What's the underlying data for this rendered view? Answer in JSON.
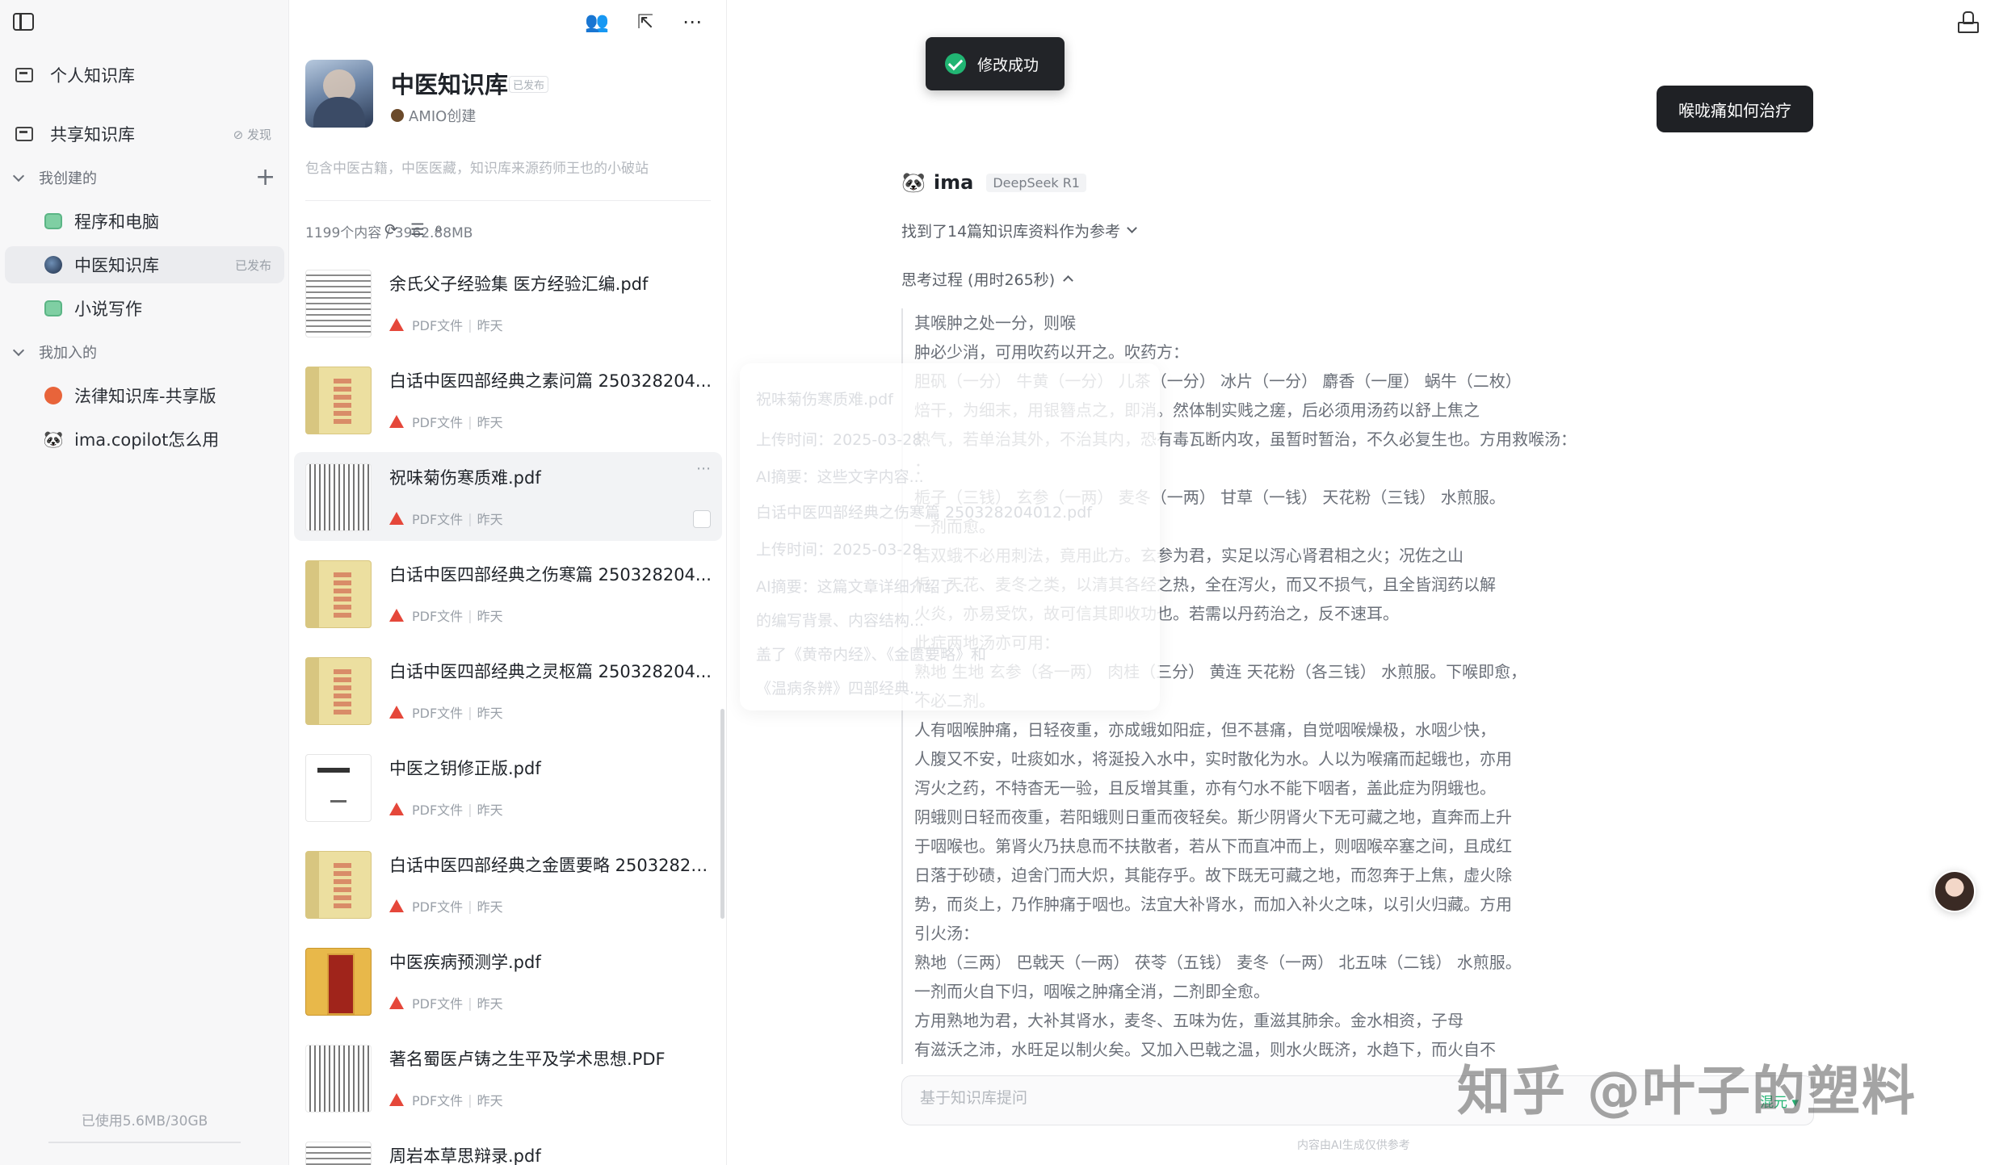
{
  "sidebar": {
    "personal_kb": "个人知识库",
    "shared_kb": "共享知识库",
    "discover": "发现",
    "my_created": "我创建的",
    "my_created_items": [
      {
        "label": "程序和电脑",
        "tag": ""
      },
      {
        "label": "中医知识库",
        "tag": "已发布"
      },
      {
        "label": "小说写作",
        "tag": ""
      }
    ],
    "my_joined": "我加入的",
    "my_joined_items": [
      {
        "label": "法律知识库-共享版"
      },
      {
        "label": "ima.copilot怎么用"
      }
    ],
    "usage": "已使用5.6MB/30GB"
  },
  "kb": {
    "title": "中医知识库",
    "status": "已发布",
    "author": "AMIO创建",
    "description": "包含中医古籍，中医医藏，知识库来源药师王也的小破站",
    "count": "1199个内容 / 3962.88MB"
  },
  "files": [
    {
      "name": "余氏父子经验集 医方经验汇编.pdf",
      "type": "PDF文件",
      "time": "昨天"
    },
    {
      "name": "白话中医四部经典之素问篇 250328204...",
      "type": "PDF文件",
      "time": "昨天"
    },
    {
      "name": "祝味菊伤寒质难.pdf",
      "type": "PDF文件",
      "time": "昨天"
    },
    {
      "name": "白话中医四部经典之伤寒篇 250328204...",
      "type": "PDF文件",
      "time": "昨天"
    },
    {
      "name": "白话中医四部经典之灵枢篇 250328204...",
      "type": "PDF文件",
      "time": "昨天"
    },
    {
      "name": "中医之钥修正版.pdf",
      "type": "PDF文件",
      "time": "昨天"
    },
    {
      "name": "白话中医四部经典之金匮要略 25032820...",
      "type": "PDF文件",
      "time": "昨天"
    },
    {
      "name": "中医疾病预测学.pdf",
      "type": "PDF文件",
      "time": "昨天"
    },
    {
      "name": "著名蜀医卢铸之生平及学术思想.PDF",
      "type": "PDF文件",
      "time": "昨天"
    },
    {
      "name": "周岩本草思辩录.pdf",
      "type": "",
      "time": ""
    }
  ],
  "chat": {
    "toast": "修改成功",
    "user_question": "喉咙痛如何治疗",
    "bot_name": "ima",
    "model": "DeepSeek R1",
    "refs": "找到了14篇知识库资料作为参考",
    "thinking": "思考过程 (用时265秒)",
    "thinking_lines": [
      "其喉肿之处一分，则喉",
      "肿必少消，可用吹药以开之。吹药方：",
      "胆矾（一分） 牛黄（一分） 儿茶（一分） 冰片（一分） 麝香（一厘） 蜗牛（二枚）",
      "焙干，为细末，用银簪点之，即消。然体制实贱之瘥，后必须用汤药以舒上焦之",
      "热气，若单治其外，不治其内，恐有毒瓦断内攻，虽暂时暂治，不久必复生也。方用救喉汤：",
      "：",
      "栀子（三钱） 玄参（一两） 麦冬（一两） 甘草（一钱） 天花粉（三钱） 水煎服。",
      "一剂而愈。",
      "若双蛾不必用刺法，竟用此方。玄参为君，实足以泻心肾君相之火；况佐之山",
      "栀、天花、麦冬之类，以清其各经之热，全在泻火，而又不损气，且全皆润药以解",
      "火炎，亦易受饮，故可信其即收功也。若需以丹药治之，反不速耳。",
      "此症两地汤亦可用：",
      "熟地 生地 玄参（各一两） 肉桂（三分） 黄连 天花粉（各三钱） 水煎服。下喉即愈，",
      "不必二剂。",
      "人有咽喉肿痛，日轻夜重，亦成蛾如阳症，但不甚痛，自觉咽喉燥极，水咽少快，",
      "人腹又不安，吐痰如水，将涎投入水中，实时散化为水。人以为喉痛而起蛾也，亦用",
      "泻火之药，不特杳无一验，且反增其重，亦有勺水不能下咽者，盖此症为阴蛾也。",
      "阴蛾则日轻而夜重，若阳蛾则日重而夜轻矣。斯少阴肾火下无可藏之地，直奔而上升",
      "于咽喉也。第肾火乃扶息而不扶散者，若从下而直冲而上，则咽喉卒塞之间，且成红",
      "日落于砂碛，迫舍门而大炽，其能存乎。故下既无可藏之地，而忽奔于上焦，虚火除",
      "势，而炎上，乃作肿痛于咽也。法宜大补肾水，而加入补火之味，以引火归藏。方用",
      "引火汤：",
      "熟地（三两） 巴戟天（一两） 茯苓（五钱） 麦冬（一两） 北五味（二钱） 水煎服。",
      "一剂而火自下归，咽喉之肿痛全消，二剂即全愈。",
      "方用熟地为君，大补其肾水，麦冬、五味为佐，重滋其肺余。金水相资，子母",
      "有滋沃之沛，水旺足以制火矣。又加入巴戟之温，则水火既济，水趋下，而火自不"
    ],
    "ghost_lines": [
      "祝味菊伤寒质难.pdf",
      "上传时间：2025-03-28",
      "AI摘要：这些文字内容...",
      "白话中医四部经典之伤寒篇 250328204012.pdf",
      "上传时间：2025-03-28",
      "AI摘要：这篇文章详细介绍了...",
      "的编写背景、内容结构...",
      "盖了《黄帝内经》、《金匮要略》和",
      "《温病条辨》四部经典..."
    ],
    "input_placeholder": "基于知识库提问",
    "model_select": "混元",
    "disclaimer": "内容由AI生成仅供参考",
    "watermark": "知乎 @叶子的塑料"
  }
}
